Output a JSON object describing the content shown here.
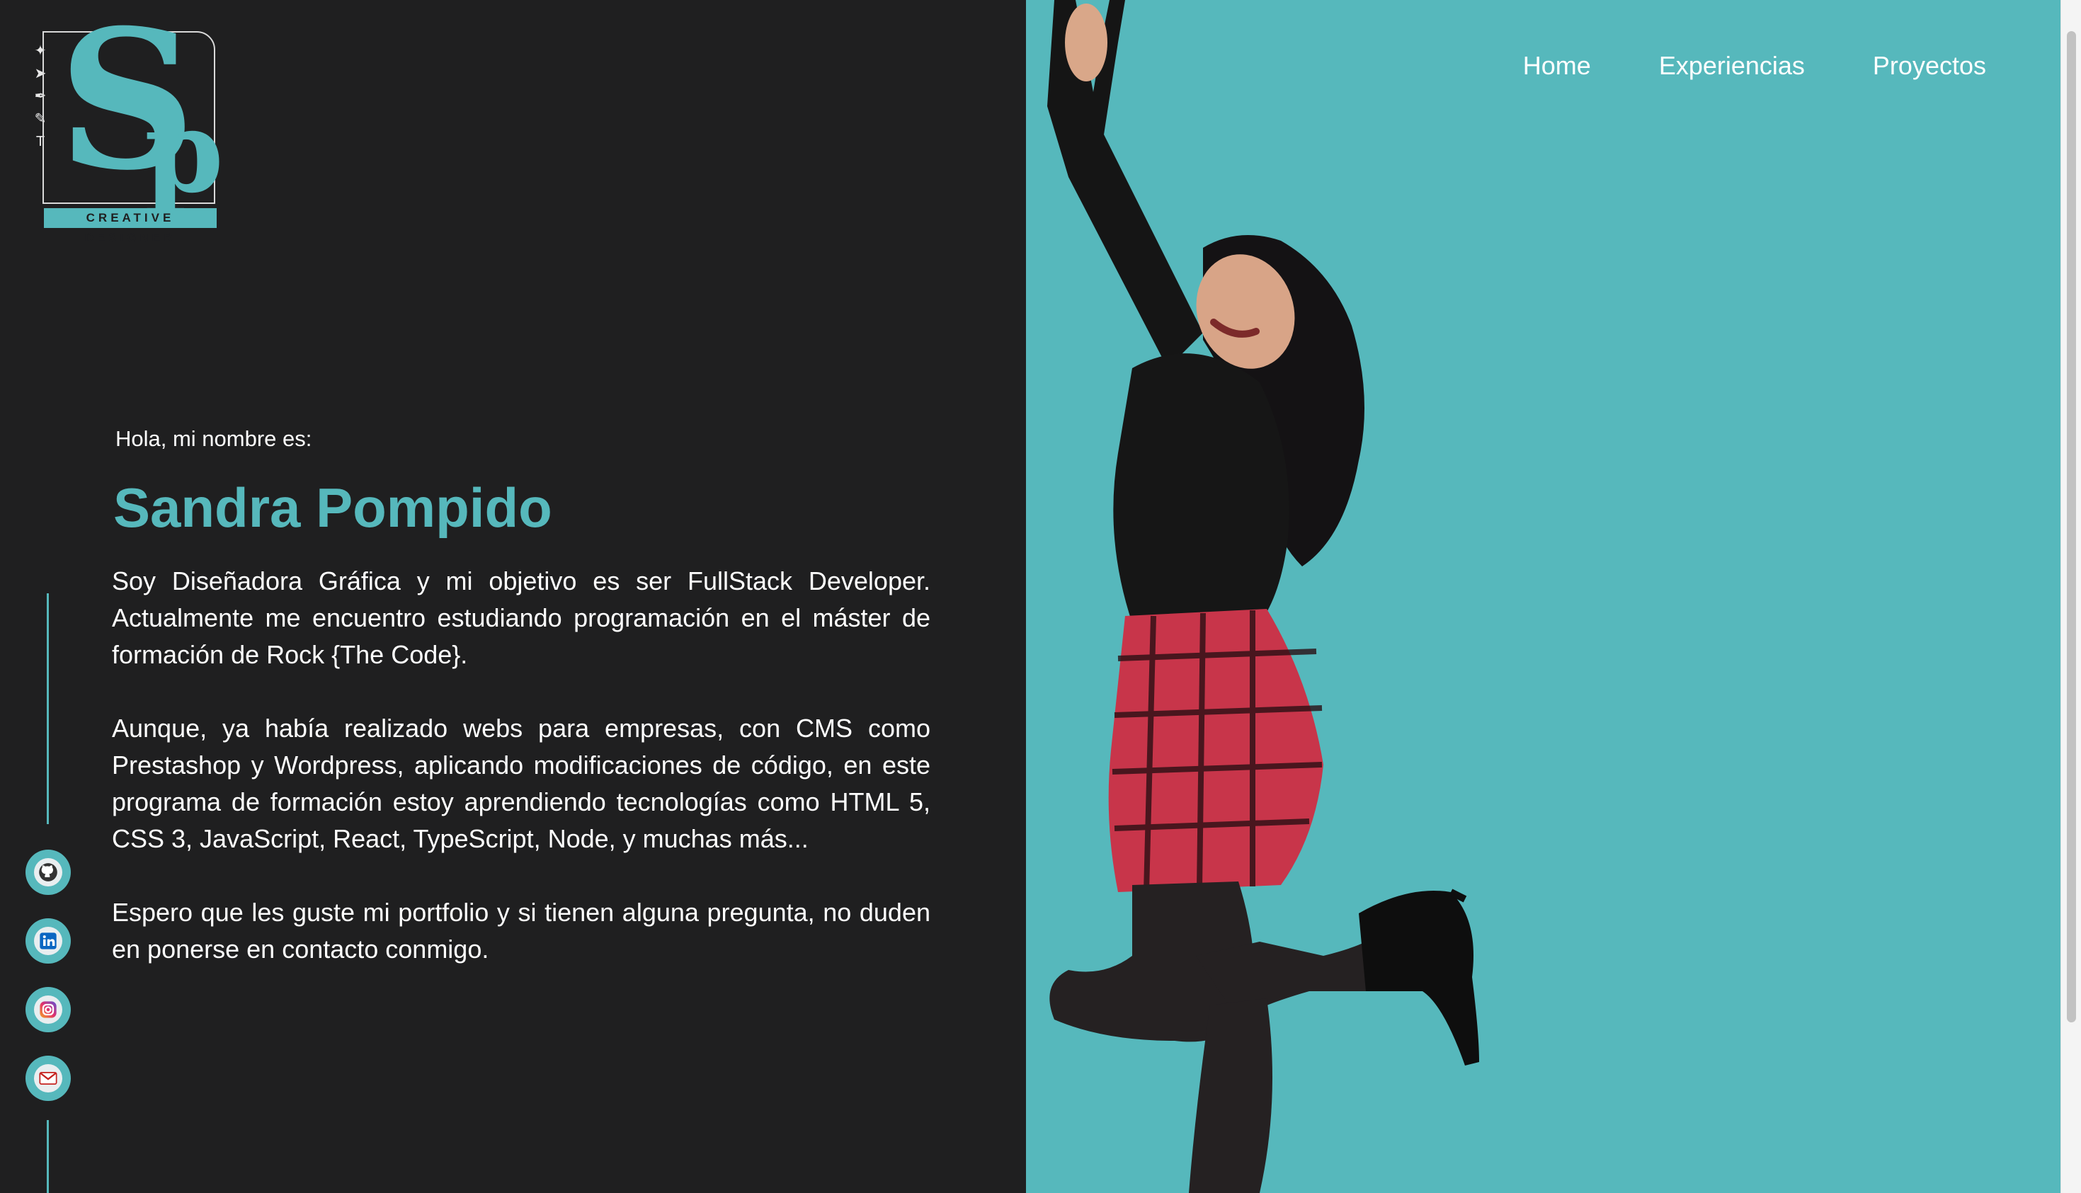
{
  "logo": {
    "monogram_s": "S",
    "monogram_p": "p",
    "tagline": "CREATIVE DESIGNER"
  },
  "nav": {
    "items": [
      "Home",
      "Experiencias",
      "Proyectos"
    ]
  },
  "intro": {
    "greeting": "Hola, mi nombre es:",
    "name": "Sandra Pompido",
    "paragraphs": [
      "Soy Diseñadora Gráfica y mi objetivo es ser FullStack Developer. Actualmente me encuentro estudiando programación en el máster de formación de Rock {The Code}.",
      "Aunque, ya había realizado webs para empresas, con CMS como Prestashop y Wordpress, aplicando modificaciones de código, en este programa de formación estoy aprendiendo tecnologías como HTML 5, CSS 3, JavaScript, React, TypeScript, Node, y muchas más...",
      "Espero que les guste mi portfolio y si tienen alguna pregunta, no duden en ponerse en contacto conmigo."
    ]
  },
  "social": {
    "icons": [
      "github-icon",
      "linkedin-icon",
      "instagram-icon",
      "gmail-icon"
    ]
  },
  "colors": {
    "accent": "#56b8bc",
    "background": "#1f1f20",
    "text": "#ffffff"
  }
}
